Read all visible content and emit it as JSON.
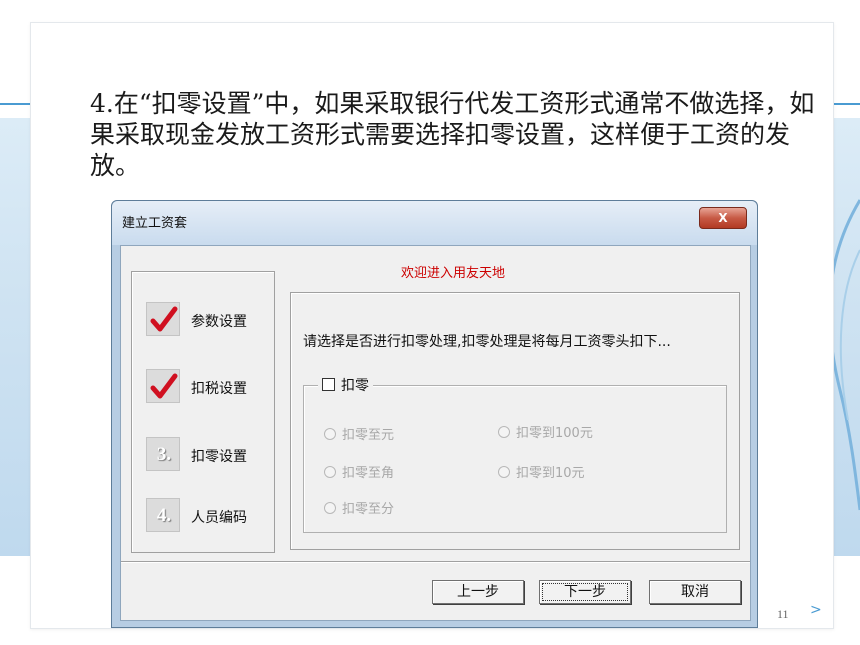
{
  "slide": {
    "text": "4.在“扣零设置”中，如果采取银行代发工资形式通常不做选择，如果采取现金发放工资形式需要选择扣零设置，这样便于工资的发放。",
    "page_number": "11",
    "next_arrow": ">"
  },
  "dialog": {
    "title": "建立工资套",
    "close_label": "X",
    "welcome": "欢迎进入用友天地",
    "steps": [
      {
        "num": "",
        "label": "参数设置",
        "done": true
      },
      {
        "num": "",
        "label": "扣税设置",
        "done": true
      },
      {
        "num": "3.",
        "label": "扣零设置",
        "done": false
      },
      {
        "num": "4.",
        "label": "人员编码",
        "done": false
      }
    ],
    "description": "请选择是否进行扣零处理,扣零处理是将每月工资零头扣下...",
    "checkbox_label": "扣零",
    "checkbox_checked": false,
    "options": [
      "扣零至元",
      "扣零到100元",
      "扣零至角",
      "扣零到10元",
      "扣零至分"
    ],
    "buttons": {
      "prev": "上一步",
      "next": "下一步",
      "cancel": "取消"
    }
  },
  "colors": {
    "accent": "#4a9bd2",
    "welcome_text": "#cc0000",
    "check_mark": "#d01020"
  }
}
